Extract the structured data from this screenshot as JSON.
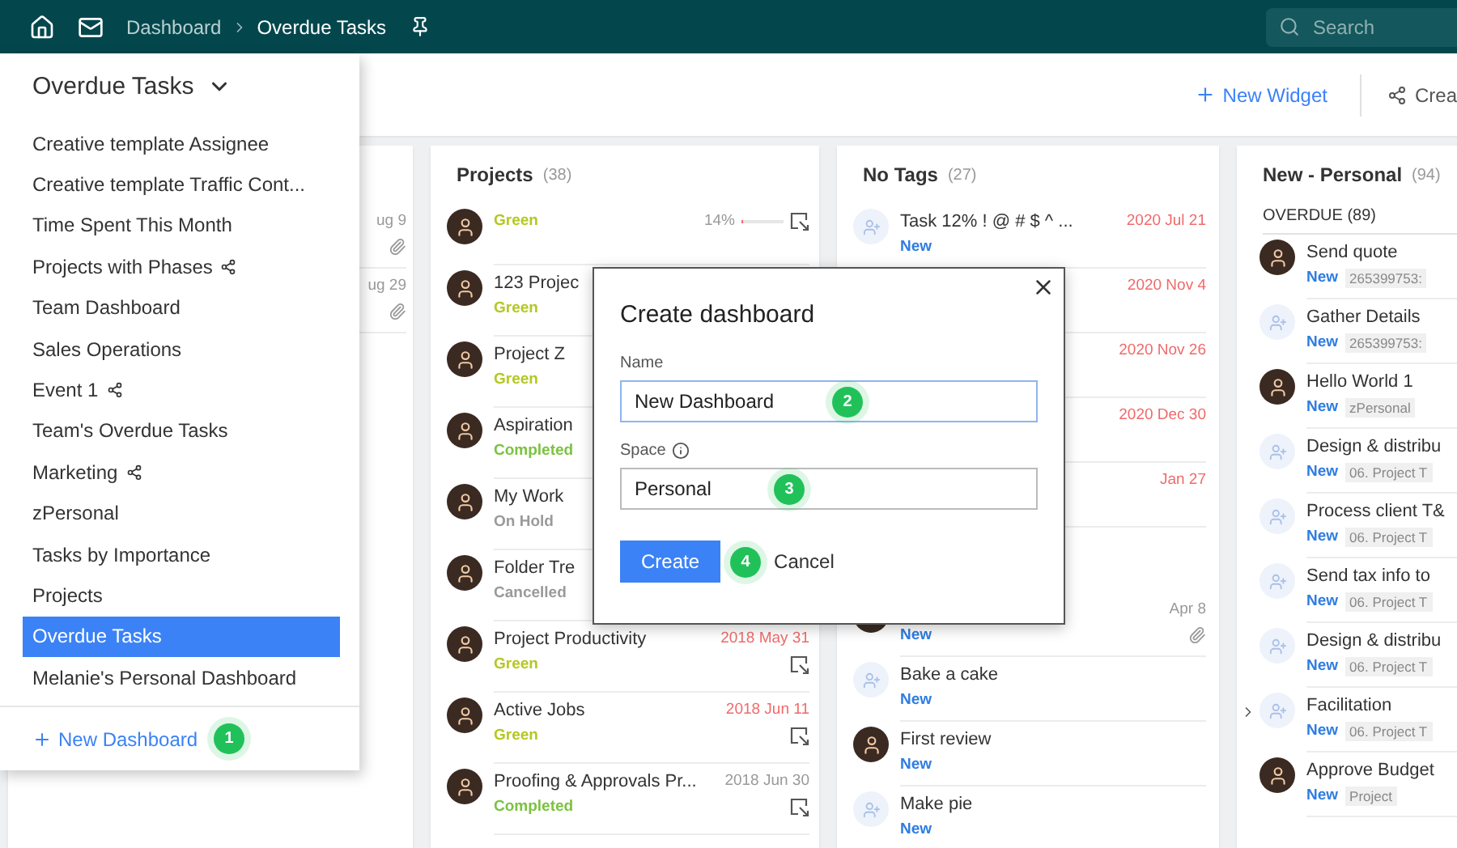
{
  "topbar": {
    "breadcrumb": [
      {
        "label": "Dashboard",
        "current": false
      },
      {
        "label": "Overdue Tasks",
        "current": true
      }
    ],
    "search_placeholder": "Search"
  },
  "toolbar": {
    "new_widget": "New Widget",
    "share": "Crea"
  },
  "columns": [
    {
      "rows": [
        {
          "date": "ug 9",
          "overdue": false,
          "attachment": true
        },
        {
          "date": "ug 29",
          "overdue": false,
          "attachment": true
        }
      ]
    },
    {
      "title": "Projects",
      "count": "(38)",
      "rows": [
        {
          "avatar": true,
          "placeholder": false,
          "status": "Green",
          "color": "#b5c823",
          "progress": {
            "label": "14%",
            "level": 0.05
          },
          "export": true
        },
        {
          "avatar": true,
          "placeholder": false,
          "title": "123 Projec",
          "status": "Green",
          "color": "#b5c823"
        },
        {
          "avatar": true,
          "placeholder": false,
          "title": "Project Z",
          "status": "Green",
          "color": "#b5c823"
        },
        {
          "avatar": true,
          "placeholder": false,
          "title": "Aspiration",
          "status": "Completed",
          "color": "#7cc242"
        },
        {
          "avatar": true,
          "placeholder": false,
          "title": "My Work",
          "status": "On Hold",
          "color": "#9a9a9a"
        },
        {
          "avatar": true,
          "placeholder": false,
          "title": "Folder Tre",
          "status": "Cancelled",
          "color": "#9a9a9a"
        },
        {
          "avatar": true,
          "placeholder": false,
          "title": "Project Productivity",
          "date": "2018 May 31",
          "overdue": true,
          "status": "Green",
          "color": "#b5c823",
          "export": true
        },
        {
          "avatar": true,
          "placeholder": false,
          "title": "Active Jobs",
          "date": "2018 Jun 11",
          "overdue": true,
          "status": "Green",
          "color": "#b5c823",
          "export": true
        },
        {
          "avatar": true,
          "placeholder": false,
          "title": "Proofing & Approvals Pr...",
          "date": "2018 Jun 30",
          "overdue": false,
          "status": "Completed",
          "color": "#7cc242",
          "export": true
        }
      ]
    },
    {
      "title": "No Tags",
      "count": "(27)",
      "rows": [
        {
          "avatar": true,
          "placeholder": true,
          "title": "Task 12% ! @ # $ ^ ...",
          "date": "2020 Jul 21",
          "overdue": true,
          "status": "New",
          "color": "#2f7de1"
        },
        {
          "date": "2020 Nov 4",
          "overdue": true
        },
        {
          "date": "2020 Nov 26",
          "overdue": true
        },
        {
          "date": "2020 Dec 30",
          "overdue": true
        },
        {
          "date": "Jan 27",
          "overdue": true
        },
        {
          "avatar": true,
          "placeholder": false,
          "date": "Apr 8",
          "overdue": false,
          "status": "New",
          "color": "#2f7de1",
          "attachment": true
        },
        {
          "avatar": true,
          "placeholder": true,
          "title": "Bake a cake",
          "status": "New",
          "color": "#2f7de1"
        },
        {
          "avatar": true,
          "placeholder": false,
          "title": "First review",
          "status": "New",
          "color": "#2f7de1"
        },
        {
          "avatar": true,
          "placeholder": true,
          "title": "Make pie",
          "status": "New",
          "color": "#2f7de1"
        }
      ]
    },
    {
      "title": "New - Personal",
      "count": "(94)",
      "group_label": "OVERDUE (89)",
      "rows": [
        {
          "avatar": true,
          "placeholder": false,
          "title": "Send quote",
          "status": "New",
          "color": "#2f7de1",
          "tag": "265399753:"
        },
        {
          "avatar": true,
          "placeholder": true,
          "title": "Gather Details",
          "status": "New",
          "color": "#2f7de1",
          "tag": "265399753:"
        },
        {
          "avatar": true,
          "placeholder": false,
          "title": "Hello World 1",
          "status": "New",
          "color": "#2f7de1",
          "tag": "zPersonal"
        },
        {
          "avatar": true,
          "placeholder": true,
          "title": "Design & distribu",
          "status": "New",
          "color": "#2f7de1",
          "tag": "06. Project T"
        },
        {
          "avatar": true,
          "placeholder": true,
          "title": "Process client T&",
          "status": "New",
          "color": "#2f7de1",
          "tag": "06. Project T"
        },
        {
          "avatar": true,
          "placeholder": true,
          "title": "Send tax info to",
          "status": "New",
          "color": "#2f7de1",
          "tag": "06. Project T"
        },
        {
          "avatar": true,
          "placeholder": true,
          "title": "Design & distribu",
          "status": "New",
          "color": "#2f7de1",
          "tag": "06. Project T"
        },
        {
          "avatar": true,
          "placeholder": true,
          "title": "Facilitation",
          "status": "New",
          "color": "#2f7de1",
          "tag": "06. Project T",
          "expandable": true
        },
        {
          "avatar": true,
          "placeholder": false,
          "title": "Approve Budget",
          "status": "New",
          "color": "#2f7de1",
          "tag": "Project"
        }
      ]
    }
  ],
  "dashboard_menu": {
    "title": "Overdue Tasks",
    "items": [
      {
        "label": "Creative template Assignee",
        "shared": false,
        "selected": false
      },
      {
        "label": "Creative template Traffic Cont...",
        "shared": false,
        "selected": false
      },
      {
        "label": "Time Spent This Month",
        "shared": false,
        "selected": false
      },
      {
        "label": "Projects with Phases",
        "shared": true,
        "selected": false
      },
      {
        "label": "Team Dashboard",
        "shared": false,
        "selected": false
      },
      {
        "label": "Sales Operations",
        "shared": false,
        "selected": false
      },
      {
        "label": "Event 1",
        "shared": true,
        "selected": false
      },
      {
        "label": "Team's Overdue Tasks",
        "shared": false,
        "selected": false
      },
      {
        "label": "Marketing",
        "shared": true,
        "selected": false
      },
      {
        "label": "zPersonal",
        "shared": false,
        "selected": false
      },
      {
        "label": "Tasks by Importance",
        "shared": false,
        "selected": false
      },
      {
        "label": "Projects",
        "shared": false,
        "selected": false
      },
      {
        "label": "Overdue Tasks",
        "shared": false,
        "selected": true
      },
      {
        "label": "Melanie's Personal Dashboard",
        "shared": false,
        "selected": false
      }
    ],
    "new_dashboard": "New Dashboard",
    "badge": "1"
  },
  "dialog": {
    "title": "Create dashboard",
    "name_label": "Name",
    "name_value": "New Dashboard",
    "name_badge": "2",
    "space_label": "Space",
    "space_value": "Personal",
    "space_badge": "3",
    "create": "Create",
    "create_badge": "4",
    "cancel": "Cancel"
  }
}
